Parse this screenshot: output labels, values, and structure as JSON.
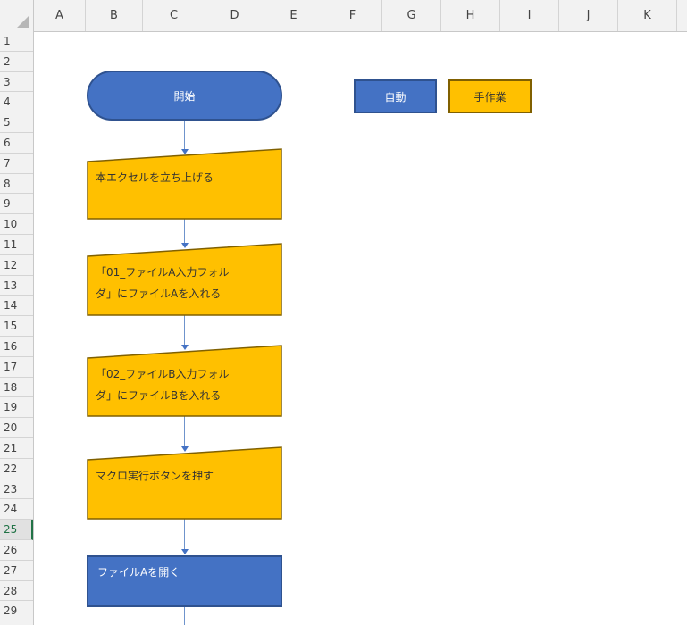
{
  "columns": [
    "A",
    "B",
    "C",
    "D",
    "E",
    "F",
    "G",
    "H",
    "I",
    "J",
    "K"
  ],
  "rows": [
    "1",
    "2",
    "3",
    "4",
    "5",
    "6",
    "7",
    "8",
    "9",
    "10",
    "11",
    "12",
    "13",
    "14",
    "15",
    "16",
    "17",
    "18",
    "19",
    "20",
    "21",
    "22",
    "23",
    "24",
    "25",
    "26",
    "27",
    "28",
    "29"
  ],
  "active_row": "25",
  "colors": {
    "auto": "#4472c4",
    "manual": "#ffc000",
    "grid_accent": "#217346"
  },
  "legend": {
    "auto": "自動",
    "manual": "手作業"
  },
  "flow": {
    "start": "開始",
    "step1": "本エクセルを立ち上げる",
    "step2_line1": "「01_ファイルA入力フォル",
    "step2_line2": "ダ」にファイルAを入れる",
    "step3_line1": "「02_ファイルB入力フォル",
    "step3_line2": "ダ」にファイルBを入れる",
    "step4": "マクロ実行ボタンを押す",
    "step5": "ファイルAを開く"
  }
}
